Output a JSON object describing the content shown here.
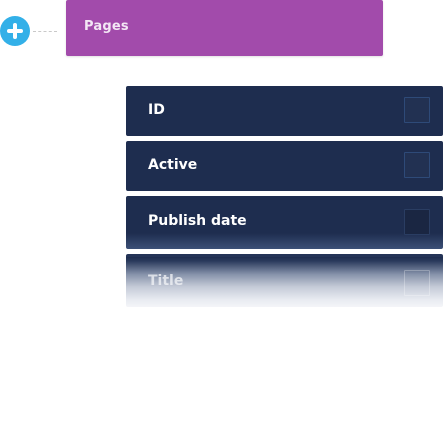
{
  "header": {
    "title": "Pages"
  },
  "fields": [
    {
      "label": "ID",
      "checked": false
    },
    {
      "label": "Active",
      "checked": false
    },
    {
      "label": "Publish date",
      "checked": false
    },
    {
      "label": "Title",
      "checked": false
    }
  ],
  "icons": {
    "add": "plus-circle-icon"
  },
  "colors": {
    "add_button": "#33b0e8",
    "header_bg": "#a24bab",
    "field_bg": "#1e2d4f",
    "field_text": "#ffffff"
  }
}
